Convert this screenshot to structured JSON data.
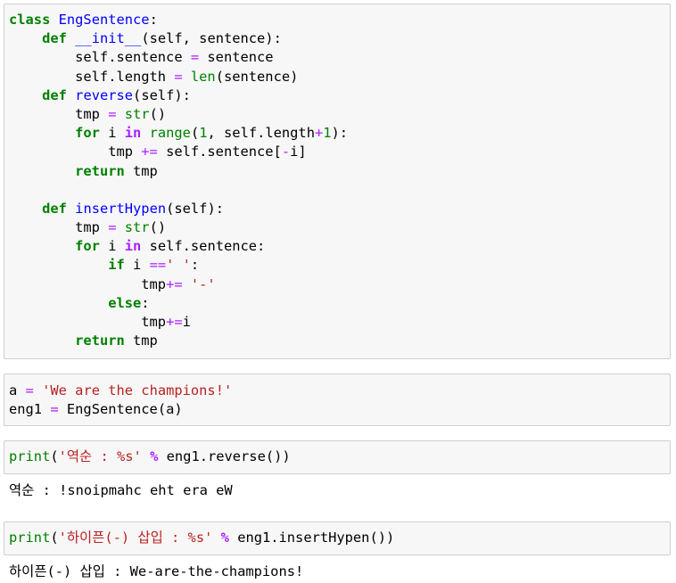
{
  "cells": {
    "class_def": {
      "lines": [
        [
          [
            "kw",
            "class"
          ],
          [
            "t",
            " "
          ],
          [
            "fn",
            "EngSentence"
          ],
          [
            "t",
            ":"
          ]
        ],
        [
          [
            "t",
            "    "
          ],
          [
            "kw",
            "def"
          ],
          [
            "t",
            " "
          ],
          [
            "fn",
            "__init__"
          ],
          [
            "t",
            "(self, sentence):"
          ]
        ],
        [
          [
            "t",
            "        self.sentence "
          ],
          [
            "op",
            "="
          ],
          [
            "t",
            " sentence"
          ]
        ],
        [
          [
            "t",
            "        self.length "
          ],
          [
            "op",
            "="
          ],
          [
            "t",
            " "
          ],
          [
            "bi",
            "len"
          ],
          [
            "t",
            "(sentence)"
          ]
        ],
        [
          [
            "t",
            "    "
          ],
          [
            "kw",
            "def"
          ],
          [
            "t",
            " "
          ],
          [
            "fn",
            "reverse"
          ],
          [
            "t",
            "(self):"
          ]
        ],
        [
          [
            "t",
            "        tmp "
          ],
          [
            "op",
            "="
          ],
          [
            "t",
            " "
          ],
          [
            "bi",
            "str"
          ],
          [
            "t",
            "()"
          ]
        ],
        [
          [
            "t",
            "        "
          ],
          [
            "kw",
            "for"
          ],
          [
            "t",
            " i "
          ],
          [
            "opw",
            "in"
          ],
          [
            "t",
            " "
          ],
          [
            "bi",
            "range"
          ],
          [
            "t",
            "("
          ],
          [
            "num",
            "1"
          ],
          [
            "t",
            ", self.length"
          ],
          [
            "op",
            "+"
          ],
          [
            "num",
            "1"
          ],
          [
            "t",
            "):"
          ]
        ],
        [
          [
            "t",
            "            tmp "
          ],
          [
            "op",
            "+="
          ],
          [
            "t",
            " self.sentence["
          ],
          [
            "op",
            "-"
          ],
          [
            "t",
            "i]"
          ]
        ],
        [
          [
            "t",
            "        "
          ],
          [
            "kw",
            "return"
          ],
          [
            "t",
            " tmp"
          ]
        ],
        [
          [
            "t",
            " "
          ]
        ],
        [
          [
            "t",
            "    "
          ],
          [
            "kw",
            "def"
          ],
          [
            "t",
            " "
          ],
          [
            "fn",
            "insertHypen"
          ],
          [
            "t",
            "(self):"
          ]
        ],
        [
          [
            "t",
            "        tmp "
          ],
          [
            "op",
            "="
          ],
          [
            "t",
            " "
          ],
          [
            "bi",
            "str"
          ],
          [
            "t",
            "()"
          ]
        ],
        [
          [
            "t",
            "        "
          ],
          [
            "kw",
            "for"
          ],
          [
            "t",
            " i "
          ],
          [
            "opw",
            "in"
          ],
          [
            "t",
            " self.sentence:"
          ]
        ],
        [
          [
            "t",
            "            "
          ],
          [
            "kw",
            "if"
          ],
          [
            "t",
            " i "
          ],
          [
            "op",
            "=="
          ],
          [
            "str",
            "' '"
          ],
          [
            "t",
            ":"
          ]
        ],
        [
          [
            "t",
            "                tmp"
          ],
          [
            "op",
            "+="
          ],
          [
            "t",
            " "
          ],
          [
            "str",
            "'-'"
          ]
        ],
        [
          [
            "t",
            "            "
          ],
          [
            "kw",
            "else"
          ],
          [
            "t",
            ":"
          ]
        ],
        [
          [
            "t",
            "                tmp"
          ],
          [
            "op",
            "+="
          ],
          [
            "t",
            "i"
          ]
        ],
        [
          [
            "t",
            "        "
          ],
          [
            "kw",
            "return"
          ],
          [
            "t",
            " tmp"
          ]
        ]
      ]
    },
    "assign": {
      "lines": [
        [
          [
            "t",
            "a "
          ],
          [
            "op",
            "="
          ],
          [
            "t",
            " "
          ],
          [
            "str",
            "'We are the champions!'"
          ]
        ],
        [
          [
            "t",
            "eng1 "
          ],
          [
            "op",
            "="
          ],
          [
            "t",
            " EngSentence(a)"
          ]
        ]
      ]
    },
    "print_reverse": {
      "lines": [
        [
          [
            "bi",
            "print"
          ],
          [
            "t",
            "("
          ],
          [
            "str",
            "'역순 : %s'"
          ],
          [
            "t",
            " "
          ],
          [
            "opw",
            "%"
          ],
          [
            "t",
            " eng1.reverse())"
          ]
        ]
      ]
    },
    "print_hyphen": {
      "lines": [
        [
          [
            "bi",
            "print"
          ],
          [
            "t",
            "("
          ],
          [
            "str",
            "'하이픈(-) 삽입 : %s'"
          ],
          [
            "t",
            " "
          ],
          [
            "opw",
            "%"
          ],
          [
            "t",
            " eng1.insertHypen())"
          ]
        ]
      ]
    }
  },
  "outputs": {
    "reverse": "역순 : !snoipmahc eht era eW",
    "hyphen": "하이픈(-) 삽입 : We-are-the-champions!"
  }
}
